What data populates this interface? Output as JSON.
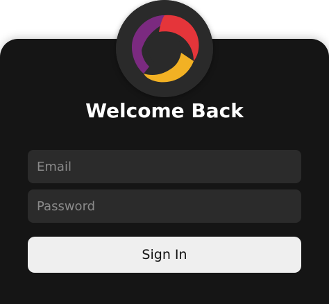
{
  "header": {
    "title": "Welcome Back"
  },
  "form": {
    "email_placeholder": "Email",
    "email_value": "",
    "password_placeholder": "Password",
    "password_value": "",
    "submit_label": "Sign In"
  },
  "logo": {
    "icon": "swirl-logo-icon",
    "colors": {
      "purple": "#7b2a80",
      "red": "#e5353a",
      "yellow": "#f2b124",
      "badge": "#2a2a2a"
    }
  },
  "theme": {
    "card_background": "#151515",
    "input_background": "#2b2b2b",
    "button_background": "#efefef",
    "title_color": "#ffffff"
  }
}
